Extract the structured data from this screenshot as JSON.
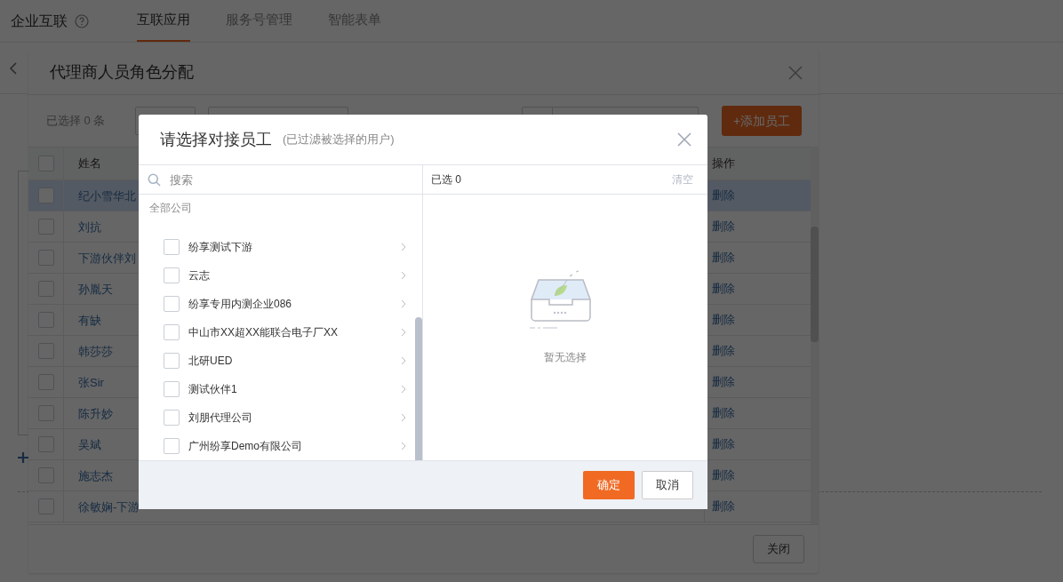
{
  "app_header": {
    "title": "企业互联",
    "tabs": [
      {
        "label": "互联应用",
        "selected": true
      },
      {
        "label": "服务号管理",
        "selected": false
      },
      {
        "label": "智能表单",
        "selected": false
      }
    ]
  },
  "role_dialog": {
    "title": "代理商人员角色分配",
    "selection_count": "已选择 0 条",
    "add_button": "+添加员工",
    "table": {
      "header_checked": false,
      "columns": [
        "姓名",
        "操作"
      ],
      "rows": [
        {
          "name": "纪小雪华北",
          "action": "删除",
          "checked": false,
          "highlighted": true
        },
        {
          "name": "刘抗",
          "action": "删除",
          "checked": false,
          "highlighted": false
        },
        {
          "name": "下游伙伴刘",
          "action": "删除",
          "checked": false,
          "highlighted": false
        },
        {
          "name": "孙胤天",
          "action": "删除",
          "checked": false,
          "highlighted": false
        },
        {
          "name": "有缺",
          "action": "删除",
          "checked": false,
          "highlighted": false
        },
        {
          "name": "韩莎莎",
          "action": "删除",
          "checked": false,
          "highlighted": false
        },
        {
          "name": "张Sir",
          "action": "删除",
          "checked": false,
          "highlighted": false
        },
        {
          "name": "陈升妙",
          "action": "删除",
          "checked": false,
          "highlighted": false
        },
        {
          "name": "吴斌",
          "action": "删除",
          "checked": false,
          "highlighted": false
        },
        {
          "name": "施志杰",
          "action": "删除",
          "checked": false,
          "highlighted": false
        },
        {
          "name": "徐敏娴-下游",
          "action": "删除",
          "checked": false,
          "highlighted": false
        }
      ]
    },
    "close_button": "关闭"
  },
  "picker_dialog": {
    "title": "请选择对接员工",
    "subtitle": "(已过滤被选择的用户)",
    "search": {
      "placeholder": "搜索"
    },
    "group_label": "全部公司",
    "companies": [
      {
        "name": "纷享测试下游",
        "checked": false
      },
      {
        "name": "云志",
        "checked": false
      },
      {
        "name": "纷享专用内测企业086",
        "checked": false
      },
      {
        "name": "中山市XX超XX能联合电子厂XX",
        "checked": false
      },
      {
        "name": "北研UED",
        "checked": false
      },
      {
        "name": "测试伙伴1",
        "checked": false
      },
      {
        "name": "刘朋代理公司",
        "checked": false
      },
      {
        "name": "广州纷享Demo有限公司",
        "checked": false
      }
    ],
    "selected_count": "已选 0",
    "clear_link": "清空",
    "empty_text": "暂无选择",
    "buttons": [
      {
        "label": "确定",
        "kind": "primary"
      },
      {
        "label": "取消",
        "kind": "secondary"
      }
    ]
  }
}
